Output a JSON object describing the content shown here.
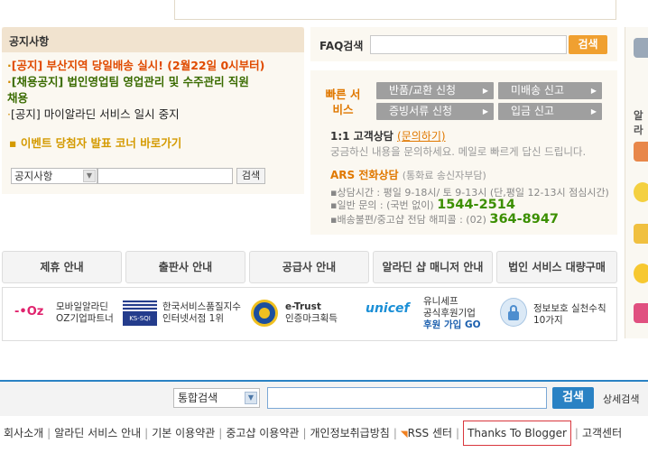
{
  "notice": {
    "title": "공지사항",
    "items": [
      {
        "prefix": "·",
        "text": "[공지] 부산지역 당일배송 실시! (2월22일 0시부터)"
      },
      {
        "prefix": "·",
        "text": "[채용공지] 법인영업팀 영업관리 및 수주관리 직원"
      },
      {
        "prefix": "",
        "text": "채용"
      },
      {
        "prefix": "·",
        "text": "[공지] 마이알라딘 서비스 일시 중지"
      }
    ],
    "event_link": "▪ 이벤트 당첨자 발표 코너 바로가기",
    "search": {
      "select_value": "공지사항",
      "button": "검색"
    }
  },
  "faq": {
    "label": "FAQ검색",
    "button": "검색"
  },
  "quick_service": {
    "label": "빠른 서비스",
    "buttons": [
      "반품/교환 신청",
      "미배송 신고",
      "증빙서류 신청",
      "입금 신고"
    ],
    "cs_title": "1:1 고객상담",
    "cs_link": "(문의하기)",
    "cs_desc": "궁금하신 내용을 문의하세요. 메일로 빠르게 답신 드립니다.",
    "ars_title": "ARS 전화상담",
    "ars_sub": "(통화료 송신자부담)",
    "lines": [
      {
        "label": "▪상담시간 : 평일 9-18시/ 토 9-13시 (단,평일 12-13시 점심시간)",
        "num": ""
      },
      {
        "label": "▪일반 문의 : (국번 없이)",
        "num": "1544-2514"
      },
      {
        "label": "▪배송불편/중고샵 전담 해피콜 : (02)",
        "num": "364-8947"
      }
    ]
  },
  "tabs": [
    "제휴 안내",
    "출판사 안내",
    "공급사 안내",
    "알라딘 샵 매니저 안내",
    "법인 서비스 대량구매"
  ],
  "partners": [
    {
      "logo": "-•Oz",
      "text": [
        "모바일알라딘",
        "OZ기업파트너"
      ]
    },
    {
      "logo": "KS-SQI",
      "text": [
        "한국서비스품질지수",
        "인터넷서점 1위"
      ]
    },
    {
      "logo": "",
      "text": [
        "e-Trust",
        "인증마크획득"
      ]
    },
    {
      "logo": "unicef",
      "text": [
        "유니세프",
        "공식후원기업",
        "후원 가입 GO"
      ]
    },
    {
      "logo": "",
      "text": [
        "정보보호 실천수칙",
        "10가지"
      ]
    }
  ],
  "right_strip": {
    "label": "알라"
  },
  "footer": {
    "select_value": "통합검색",
    "search_button": "검색",
    "detail": "상세검색",
    "links": [
      "회사소개",
      "알라딘 서비스 안내",
      "기본 이용약관",
      "중고샵 이용약관",
      "개인정보취급방침",
      "RSS 센터",
      "Thanks To Blogger",
      "고객센터"
    ]
  },
  "colors": {
    "accent_orange": "#f0a030",
    "footer_blue": "#2a82c4",
    "highlight": "#d9373d"
  }
}
